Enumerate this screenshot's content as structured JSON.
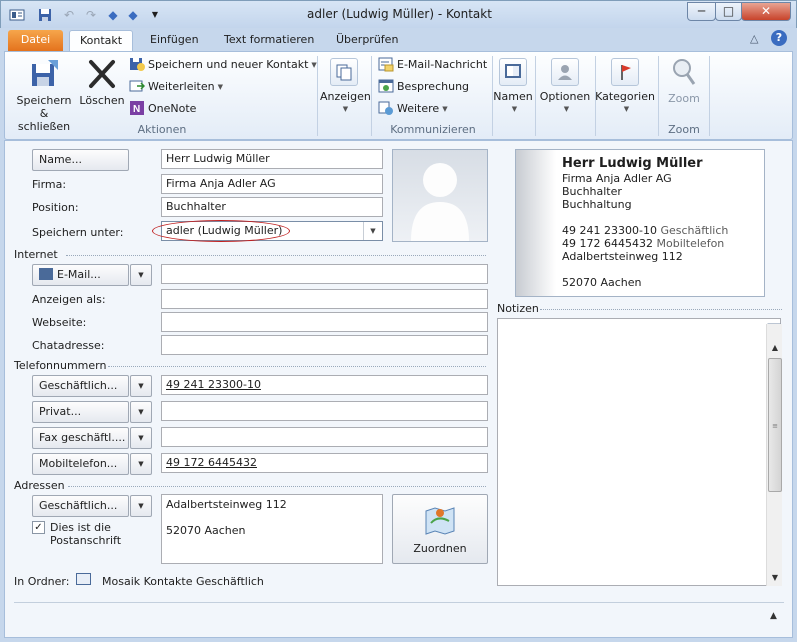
{
  "window": {
    "title": "adler (Ludwig Müller)  -  Kontakt",
    "minimize_glyph": "─",
    "maximize_glyph": "□",
    "close_glyph": "✕"
  },
  "tabs": [
    {
      "label": "Datei"
    },
    {
      "label": "Kontakt"
    },
    {
      "label": "Einfügen"
    },
    {
      "label": "Text formatieren"
    },
    {
      "label": "Überprüfen"
    }
  ],
  "ribbon": {
    "aktionen": {
      "label": "Aktionen",
      "save_close_line1": "Speichern",
      "save_close_line2": "& schließen",
      "delete": "Löschen",
      "save_new": "Speichern und neuer Kontakt",
      "forward": "Weiterleiten",
      "onenote": "OneNote"
    },
    "anzeigen": {
      "label": "Anzeigen"
    },
    "kommunizieren": {
      "label": "Kommunizieren",
      "email": "E-Mail-Nachricht",
      "meeting": "Besprechung",
      "more": "Weitere"
    },
    "namen": {
      "label": "Namen"
    },
    "optionen": {
      "label": "Optionen"
    },
    "kategorien": {
      "label": "Kategorien"
    },
    "zoom": {
      "button": "Zoom",
      "label": "Zoom"
    }
  },
  "form": {
    "name_button": "Name...",
    "name_value": "Herr Ludwig Müller",
    "firma_label": "Firma:",
    "firma_value": "Firma Anja Adler AG",
    "position_label": "Position:",
    "position_value": "Buchhalter",
    "speichern_label": "Speichern unter:",
    "speichern_value": "adler (Ludwig Müller)",
    "internet_section": "Internet",
    "email_button": "E-Mail...",
    "email_value": "",
    "anzeigen_label": "Anzeigen als:",
    "anzeigen_value": "",
    "webseite_label": "Webseite:",
    "webseite_value": "",
    "chat_label": "Chatadresse:",
    "chat_value": "",
    "telefon_section": "Telefonnummern",
    "phones": [
      {
        "button": "Geschäftlich...",
        "value": "49 241 23300-10"
      },
      {
        "button": "Privat...",
        "value": ""
      },
      {
        "button": "Fax geschäftl....",
        "value": ""
      },
      {
        "button": "Mobiltelefon...",
        "value": "49 172 6445432"
      }
    ],
    "adressen_section": "Adressen",
    "address_button": "Geschäftlich...",
    "address_line1": "Adalbertsteinweg 112",
    "address_line2": "52070  Aachen",
    "postal_check_line1": "Dies ist die",
    "postal_check_line2": "Postanschrift",
    "zuordnen": "Zuordnen",
    "in_ordner_label": "In Ordner:",
    "in_ordner_value": "Mosaik Kontakte Geschäftlich",
    "notizen_label": "Notizen"
  },
  "card": {
    "name": "Herr Ludwig Müller",
    "company": "Firma Anja Adler AG",
    "job": "Buchhalter",
    "department": "Buchhaltung",
    "phone1": "49 241 23300-10",
    "phone1_label": "Geschäftlich",
    "phone2": "49 172 6445432",
    "phone2_label": "Mobiltelefon",
    "street": "Adalbertsteinweg 112",
    "city": "52070  Aachen"
  },
  "colors": {
    "accent_orange": "#e3701b",
    "ribbon_blue": "#c6d7ec",
    "link_underline": "#1e1e1e"
  }
}
